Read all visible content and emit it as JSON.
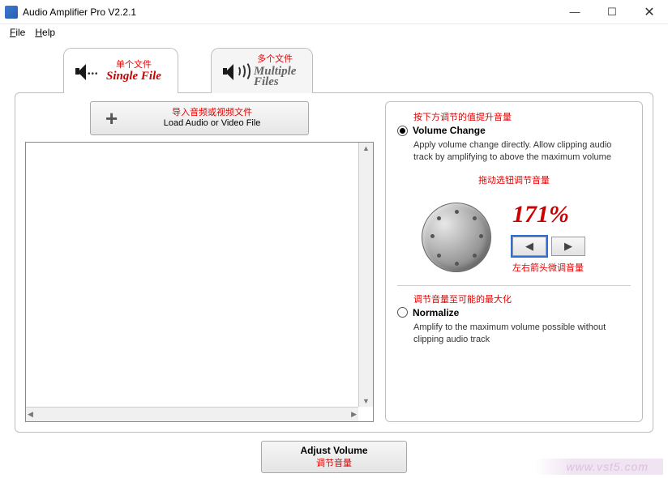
{
  "window": {
    "title": "Audio Amplifier Pro V2.2.1"
  },
  "menu": {
    "file": "File",
    "help": "Help"
  },
  "tabs": {
    "single": {
      "caption_cn": "单个文件",
      "label": "Single File"
    },
    "multiple": {
      "caption_cn": "多个文件",
      "label_line1": "Multiple",
      "label_line2": "Files"
    }
  },
  "load_button": {
    "caption_cn": "导入音频或视频文件",
    "label": "Load Audio or Video File"
  },
  "options": {
    "volume_change": {
      "caption_cn": "按下方调节的值提升音量",
      "title": "Volume Change",
      "desc": "Apply volume change directly. Allow clipping audio track by amplifying to above the maximum volume",
      "knob_caption_cn": "拖动选钮调节音量",
      "value_pct": "171%",
      "arrows_caption_cn": "左右箭头微调音量"
    },
    "normalize": {
      "caption_cn": "调节音量至可能的最大化",
      "title": "Normalize",
      "desc": "Amplify to the maximum volume possible without clipping audio track"
    }
  },
  "adjust_button": {
    "label": "Adjust Volume",
    "caption_cn": "调节音量"
  },
  "watermark": "www.vst5.com"
}
